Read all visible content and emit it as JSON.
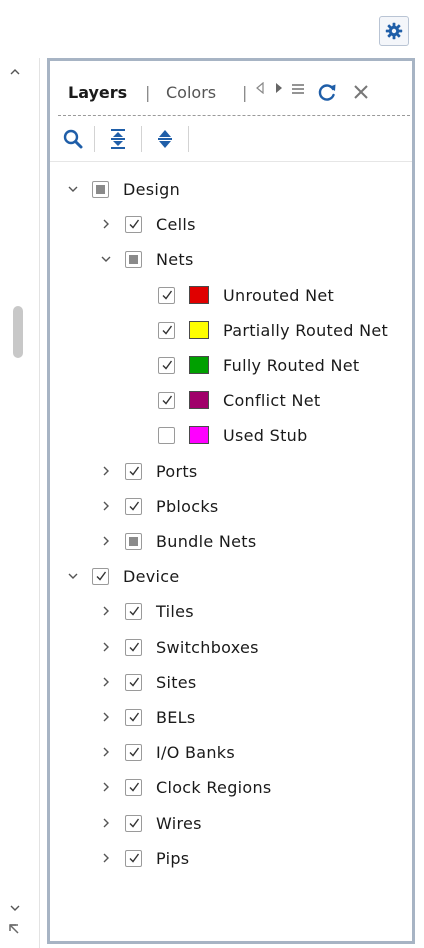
{
  "window": {
    "settings_icon": "gear-icon"
  },
  "panel": {
    "tabs": [
      {
        "label": "Layers",
        "active": true
      },
      {
        "label": "Colors",
        "active": false
      }
    ],
    "tab_separator": "|",
    "nav_icons": [
      "tab-left-arrow-icon",
      "tab-right-arrow-icon",
      "tab-list-icon"
    ],
    "refresh_icon": "refresh-icon",
    "close_icon": "close-icon",
    "toolbar": [
      "search-icon",
      "collapse-all-icon",
      "expand-all-icon"
    ],
    "tree": [
      {
        "label": "Design",
        "level": 0,
        "expand": "expanded",
        "check": "partial"
      },
      {
        "label": "Cells",
        "level": 1,
        "expand": "collapsed",
        "check": "checked"
      },
      {
        "label": "Nets",
        "level": 1,
        "expand": "expanded",
        "check": "partial"
      },
      {
        "label": "Unrouted Net",
        "level": 2,
        "expand": "none",
        "check": "checked",
        "color": "#e00000"
      },
      {
        "label": "Partially Routed Net",
        "level": 2,
        "expand": "none",
        "check": "checked",
        "color": "#ffff00"
      },
      {
        "label": "Fully Routed Net",
        "level": 2,
        "expand": "none",
        "check": "checked",
        "color": "#00a000"
      },
      {
        "label": "Conflict Net",
        "level": 2,
        "expand": "none",
        "check": "checked",
        "color": "#a0006a"
      },
      {
        "label": "Used Stub",
        "level": 2,
        "expand": "none",
        "check": "unchecked",
        "color": "#ff00ff"
      },
      {
        "label": "Ports",
        "level": 1,
        "expand": "collapsed",
        "check": "checked"
      },
      {
        "label": "Pblocks",
        "level": 1,
        "expand": "collapsed",
        "check": "checked"
      },
      {
        "label": "Bundle Nets",
        "level": 1,
        "expand": "collapsed",
        "check": "partial"
      },
      {
        "label": "Device",
        "level": 0,
        "expand": "expanded",
        "check": "checked"
      },
      {
        "label": "Tiles",
        "level": 1,
        "expand": "collapsed",
        "check": "checked"
      },
      {
        "label": "Switchboxes",
        "level": 1,
        "expand": "collapsed",
        "check": "checked"
      },
      {
        "label": "Sites",
        "level": 1,
        "expand": "collapsed",
        "check": "checked"
      },
      {
        "label": "BELs",
        "level": 1,
        "expand": "collapsed",
        "check": "checked"
      },
      {
        "label": "I/O Banks",
        "level": 1,
        "expand": "collapsed",
        "check": "checked"
      },
      {
        "label": "Clock Regions",
        "level": 1,
        "expand": "collapsed",
        "check": "checked"
      },
      {
        "label": "Wires",
        "level": 1,
        "expand": "collapsed",
        "check": "checked"
      },
      {
        "label": "Pips",
        "level": 1,
        "expand": "collapsed",
        "check": "checked"
      }
    ]
  },
  "scrollbar": {
    "up_icon": "scroll-up-icon",
    "down_icon": "scroll-down-icon",
    "corner_icon": "resize-corner-icon"
  },
  "colors": {
    "accent": "#1f5ea8",
    "panel_border": "#a7b4c4"
  }
}
